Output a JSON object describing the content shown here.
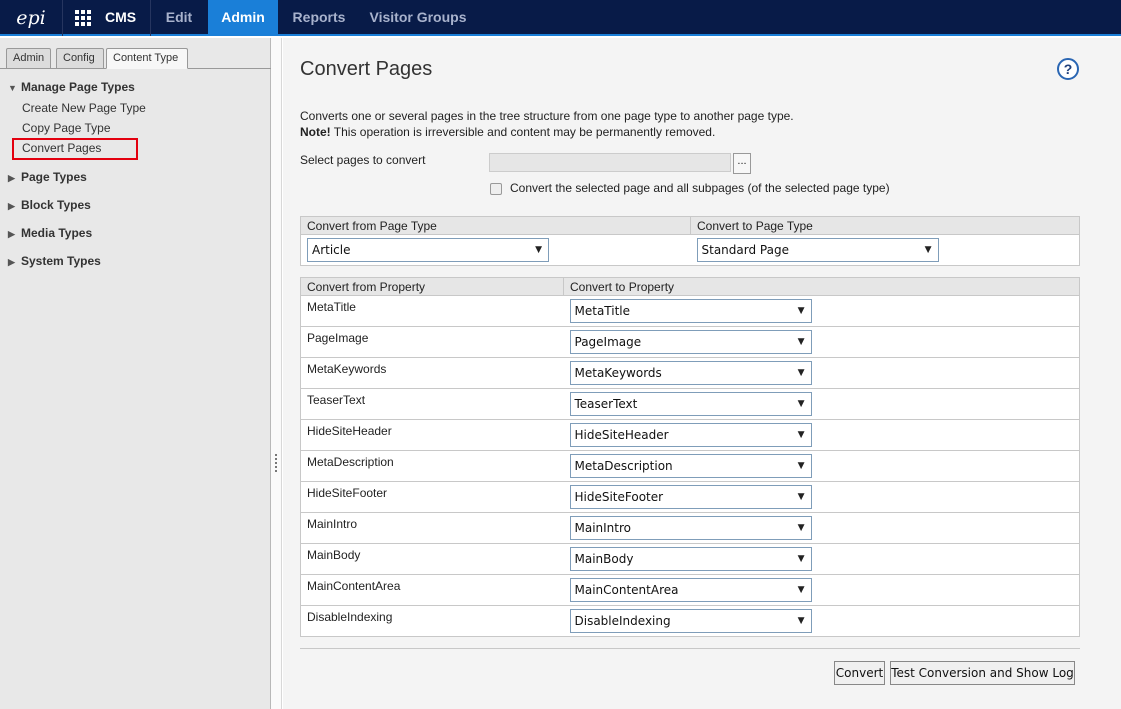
{
  "topbar": {
    "logo_text": "epi",
    "cms_label": "CMS",
    "nav": [
      {
        "label": "Edit",
        "active": false
      },
      {
        "label": "Admin",
        "active": true
      },
      {
        "label": "Reports",
        "active": false
      },
      {
        "label": "Visitor Groups",
        "active": false
      }
    ],
    "accent_color": "#1a7fd8",
    "background_color": "#081b48"
  },
  "sidebar": {
    "tabs": [
      {
        "label": "Admin",
        "active": false
      },
      {
        "label": "Config",
        "active": false
      },
      {
        "label": "Content Type",
        "active": true
      }
    ],
    "groups": [
      {
        "label": "Manage Page Types",
        "expanded": true,
        "items": [
          "Create New Page Type",
          "Copy Page Type",
          "Convert Pages"
        ]
      },
      {
        "label": "Page Types",
        "expanded": false
      },
      {
        "label": "Block Types",
        "expanded": false
      },
      {
        "label": "Media Types",
        "expanded": false
      },
      {
        "label": "System Types",
        "expanded": false
      }
    ],
    "selected_item": "Convert Pages",
    "highlight_color": "#e3000f"
  },
  "main": {
    "title": "Convert Pages",
    "help_label": "?",
    "description": "Converts one or several pages in the tree structure from one page type to another page type.",
    "note_label": "Note!",
    "note_text": " This operation is irreversible and content may be permanently removed.",
    "select_pages_label": "Select pages to convert",
    "select_pages_value": "",
    "browse_label": "...",
    "subpages_checkbox_label": "Convert the selected page and all subpages (of the selected page type)",
    "subpages_checked": false,
    "type_headers": [
      "Convert from Page Type",
      "Convert to Page Type"
    ],
    "from_page_type": "Article",
    "to_page_type": "Standard Page",
    "property_headers": [
      "Convert from Property",
      "Convert to Property"
    ],
    "properties": [
      {
        "from": "MetaTitle",
        "to": "MetaTitle"
      },
      {
        "from": "PageImage",
        "to": "PageImage"
      },
      {
        "from": "MetaKeywords",
        "to": "MetaKeywords"
      },
      {
        "from": "TeaserText",
        "to": "TeaserText"
      },
      {
        "from": "HideSiteHeader",
        "to": "HideSiteHeader"
      },
      {
        "from": "MetaDescription",
        "to": "MetaDescription"
      },
      {
        "from": "HideSiteFooter",
        "to": "HideSiteFooter"
      },
      {
        "from": "MainIntro",
        "to": "MainIntro"
      },
      {
        "from": "MainBody",
        "to": "MainBody"
      },
      {
        "from": "MainContentArea",
        "to": "MainContentArea"
      },
      {
        "from": "DisableIndexing",
        "to": "DisableIndexing"
      }
    ],
    "convert_button": "Convert",
    "test_button": "Test Conversion and Show Log"
  }
}
